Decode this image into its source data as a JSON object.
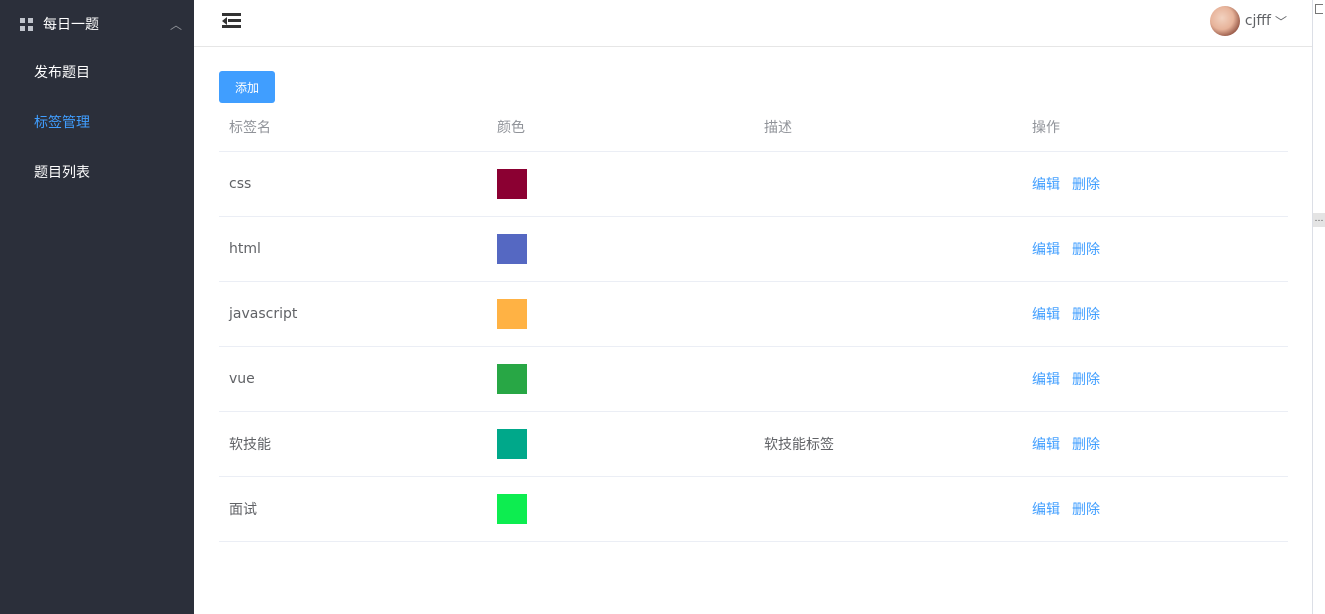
{
  "sidebar": {
    "group_title": "每日一题",
    "items": [
      {
        "label": "发布题目",
        "active": false
      },
      {
        "label": "标签管理",
        "active": true
      },
      {
        "label": "题目列表",
        "active": false
      }
    ]
  },
  "header": {
    "username": "cjfff"
  },
  "toolbar": {
    "add_label": "添加"
  },
  "table": {
    "columns": [
      "标签名",
      "颜色",
      "描述",
      "操作"
    ],
    "edit_label": "编辑",
    "delete_label": "删除",
    "rows": [
      {
        "name": "css",
        "color": "#8b0032",
        "desc": ""
      },
      {
        "name": "html",
        "color": "#5568c2",
        "desc": ""
      },
      {
        "name": "javascript",
        "color": "#ffb244",
        "desc": ""
      },
      {
        "name": "vue",
        "color": "#28a745",
        "desc": ""
      },
      {
        "name": "软技能",
        "color": "#00a88a",
        "desc": "软技能标签"
      },
      {
        "name": "面试",
        "color": "#0ded50",
        "desc": ""
      }
    ]
  },
  "colors": {
    "accent": "#409eff",
    "sidebar_bg": "#2b2f3a"
  }
}
